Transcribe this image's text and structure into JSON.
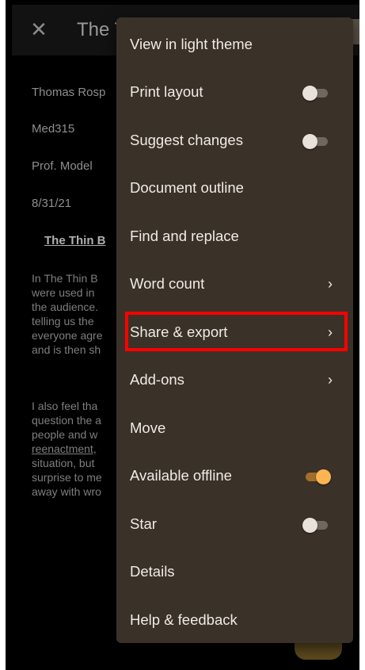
{
  "app_bar": {
    "close_icon": "close-icon",
    "title": "The T"
  },
  "document": {
    "header_lines": [
      "Thomas Rosp",
      "Med315",
      "Prof. Model",
      "8/31/21"
    ],
    "heading": "The Thin B",
    "paragraph1": [
      "In The Thin B",
      "were used in",
      "the audience.",
      "telling us the",
      "everyone agre",
      "and is then sh"
    ],
    "paragraph2": [
      "I also feel tha",
      "question the a",
      "people and w",
      "reenactment,",
      "situation, but",
      "surprise to me",
      "away with wro"
    ]
  },
  "menu": {
    "items": [
      {
        "label": "View in light theme",
        "trailing": "none"
      },
      {
        "label": "Print layout",
        "trailing": "switch",
        "state": "off"
      },
      {
        "label": "Suggest changes",
        "trailing": "switch",
        "state": "off"
      },
      {
        "label": "Document outline",
        "trailing": "none"
      },
      {
        "label": "Find and replace",
        "trailing": "none"
      },
      {
        "label": "Word count",
        "trailing": "chevron"
      },
      {
        "label": "Share & export",
        "trailing": "chevron",
        "highlighted": true
      },
      {
        "label": "Add-ons",
        "trailing": "chevron"
      },
      {
        "label": "Move",
        "trailing": "none"
      },
      {
        "label": "Available offline",
        "trailing": "switch",
        "state": "on"
      },
      {
        "label": "Star",
        "trailing": "switch",
        "state": "off"
      },
      {
        "label": "Details",
        "trailing": "none"
      },
      {
        "label": "Help & feedback",
        "trailing": "none"
      }
    ],
    "chevron_glyph": "›"
  },
  "colors": {
    "menu_background": "#3a3129",
    "switch_on": "#fcb552",
    "highlight_box": "#ff0000"
  }
}
